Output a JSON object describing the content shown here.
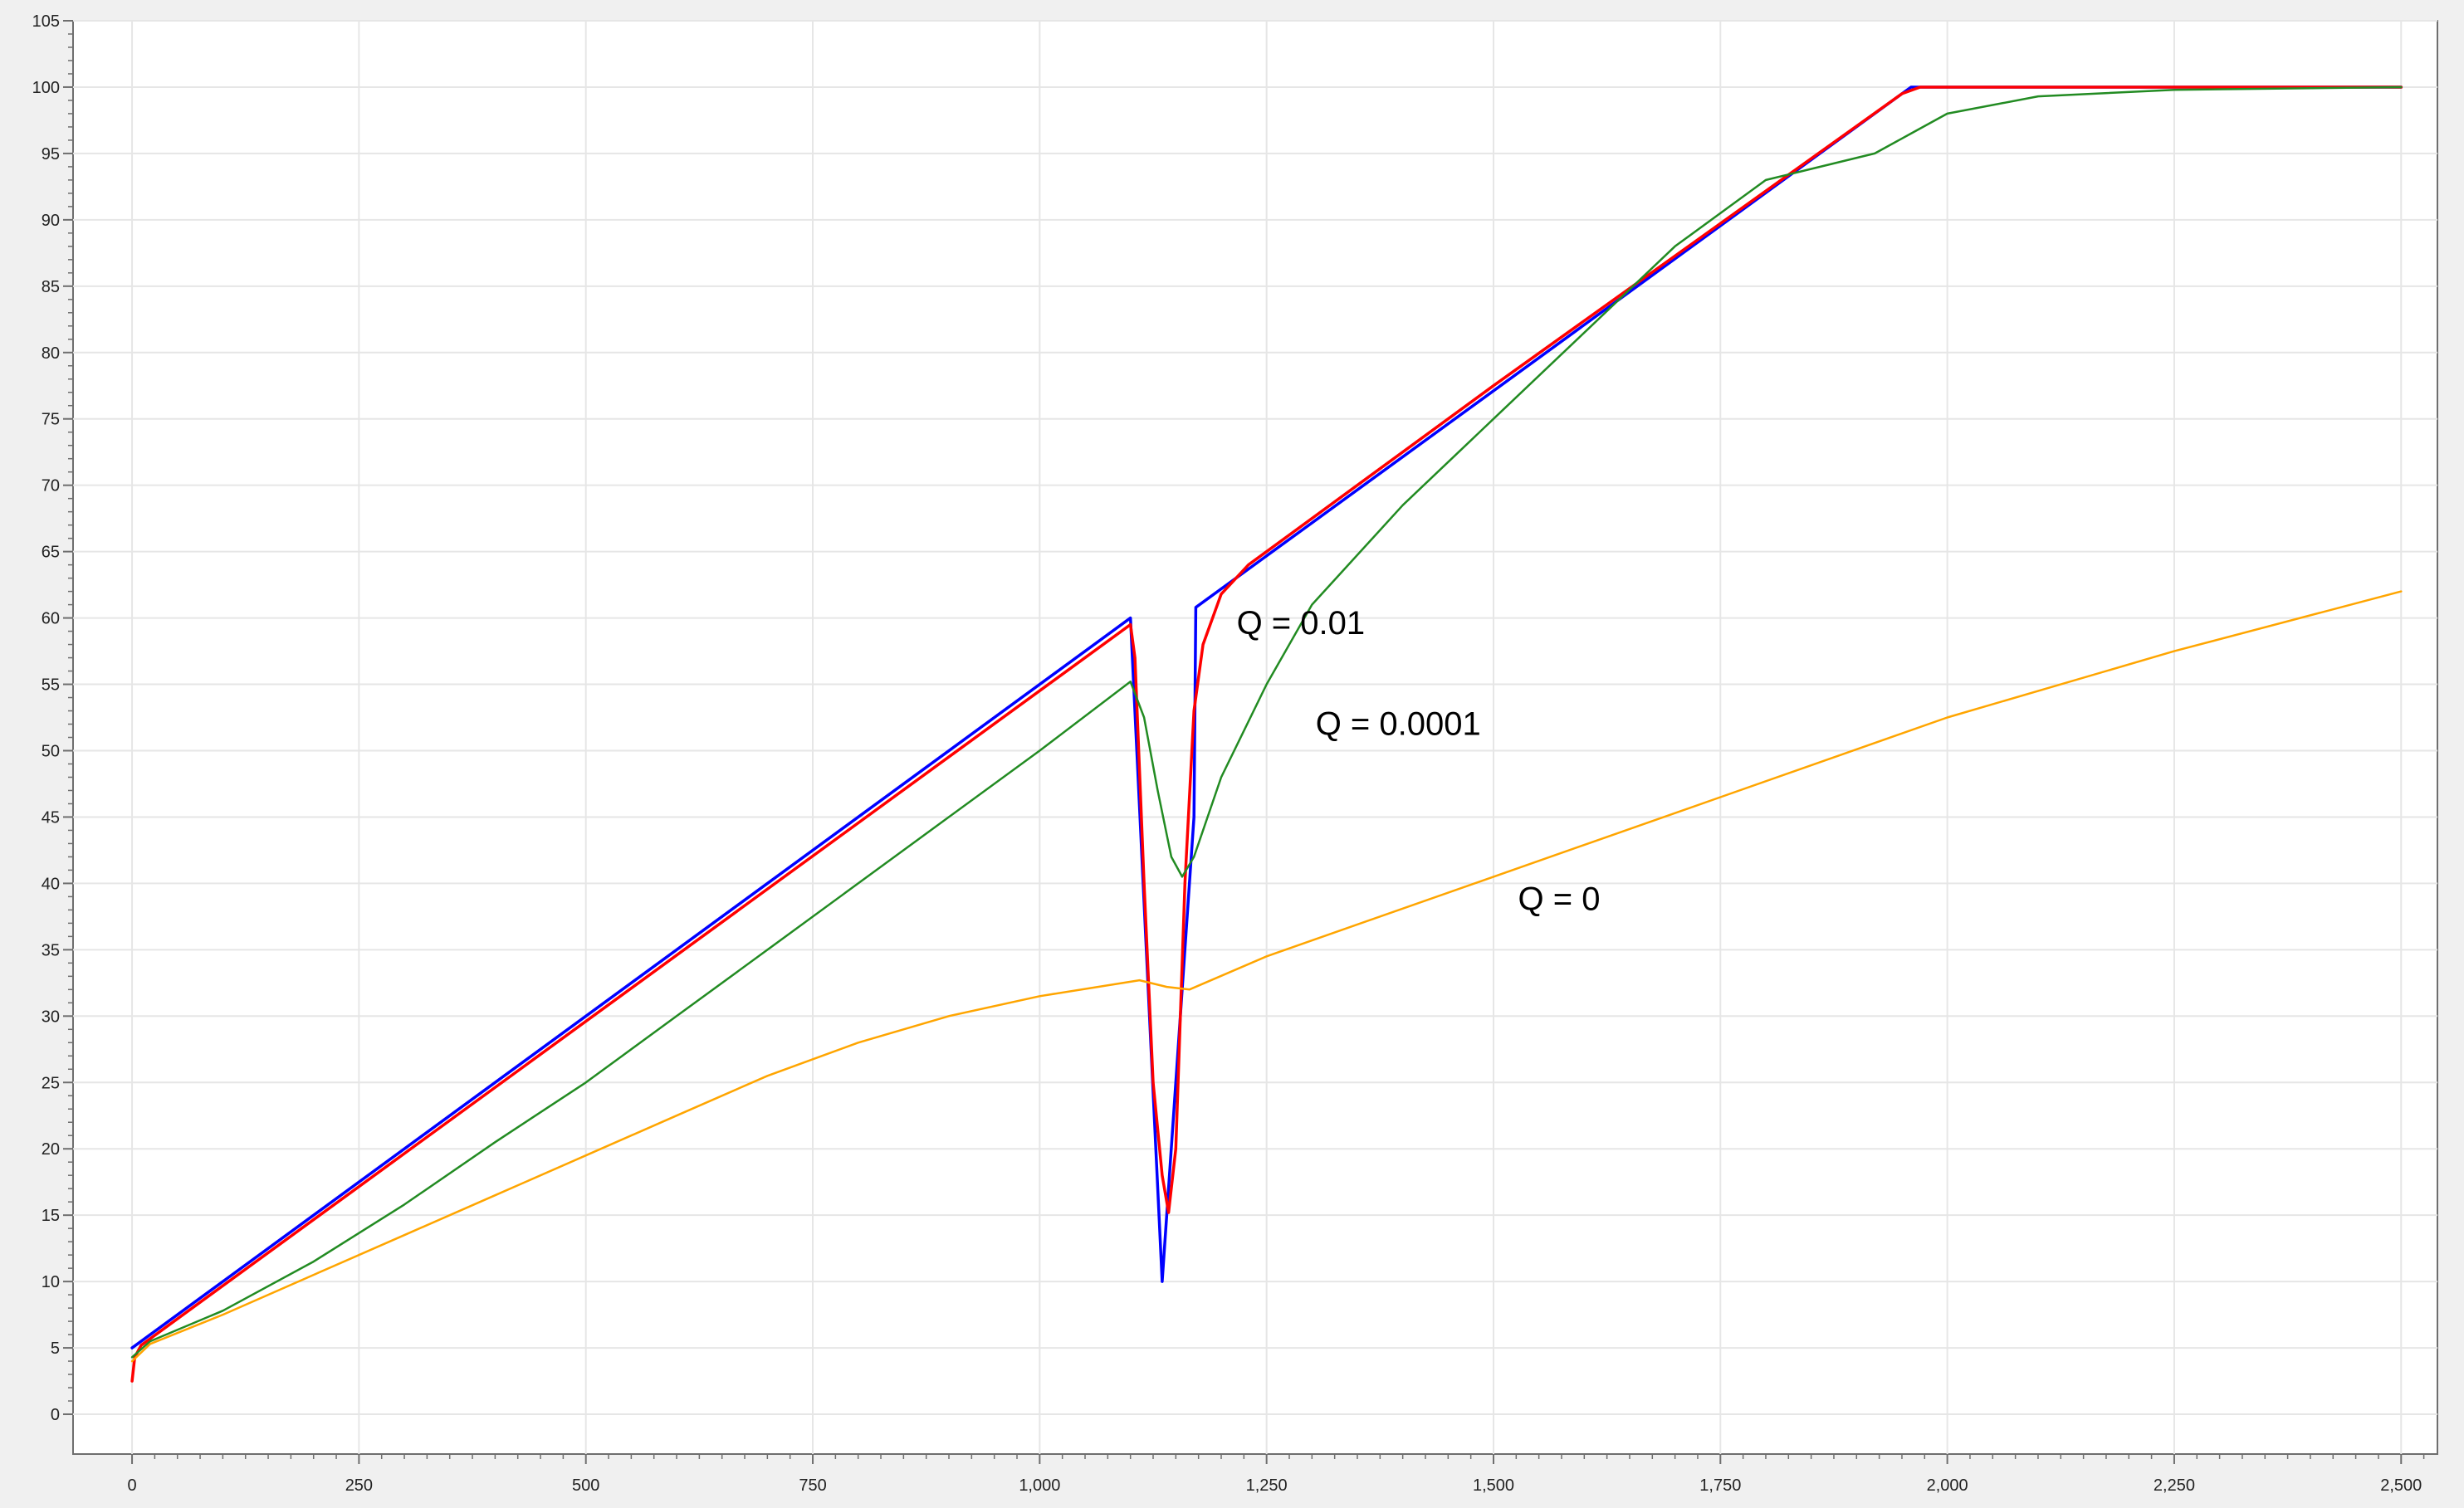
{
  "chart_data": {
    "type": "line",
    "title": "",
    "xlabel": "",
    "ylabel": "",
    "xlim": [
      -65,
      2540
    ],
    "ylim": [
      -3,
      105
    ],
    "x_ticks": [
      {
        "value": 0,
        "label": "0"
      },
      {
        "value": 250,
        "label": "250"
      },
      {
        "value": 500,
        "label": "500"
      },
      {
        "value": 750,
        "label": "750"
      },
      {
        "value": 1000,
        "label": "1,000"
      },
      {
        "value": 1250,
        "label": "1,250"
      },
      {
        "value": 1500,
        "label": "1,500"
      },
      {
        "value": 1750,
        "label": "1,750"
      },
      {
        "value": 2000,
        "label": "2,000"
      },
      {
        "value": 2250,
        "label": "2,250"
      },
      {
        "value": 2500,
        "label": "2,500"
      }
    ],
    "y_ticks": [
      {
        "value": 0,
        "label": "0"
      },
      {
        "value": 5,
        "label": "5"
      },
      {
        "value": 10,
        "label": "10"
      },
      {
        "value": 15,
        "label": "15"
      },
      {
        "value": 20,
        "label": "20"
      },
      {
        "value": 25,
        "label": "25"
      },
      {
        "value": 30,
        "label": "30"
      },
      {
        "value": 35,
        "label": "35"
      },
      {
        "value": 40,
        "label": "40"
      },
      {
        "value": 45,
        "label": "45"
      },
      {
        "value": 50,
        "label": "50"
      },
      {
        "value": 55,
        "label": "55"
      },
      {
        "value": 60,
        "label": "60"
      },
      {
        "value": 65,
        "label": "65"
      },
      {
        "value": 70,
        "label": "70"
      },
      {
        "value": 75,
        "label": "75"
      },
      {
        "value": 80,
        "label": "80"
      },
      {
        "value": 85,
        "label": "85"
      },
      {
        "value": 90,
        "label": "90"
      },
      {
        "value": 95,
        "label": "95"
      },
      {
        "value": 100,
        "label": "100"
      },
      {
        "value": 105,
        "label": "105"
      }
    ],
    "grid": true,
    "legend": "none",
    "series": [
      {
        "color": "#0000ff",
        "points": [
          [
            0,
            5
          ],
          [
            1100,
            60
          ],
          [
            1135,
            10
          ],
          [
            1170,
            45
          ],
          [
            1172,
            60.8
          ],
          [
            1960,
            100
          ],
          [
            2500,
            100
          ]
        ]
      },
      {
        "color": "#ff0000",
        "points": [
          [
            0,
            2.5
          ],
          [
            3,
            4.3
          ],
          [
            10,
            5.2
          ],
          [
            1100,
            59.5
          ],
          [
            1105,
            57
          ],
          [
            1115,
            40
          ],
          [
            1125,
            25
          ],
          [
            1135,
            18
          ],
          [
            1142,
            15.2
          ],
          [
            1150,
            20
          ],
          [
            1160,
            40
          ],
          [
            1170,
            53
          ],
          [
            1180,
            58
          ],
          [
            1200,
            61.8
          ],
          [
            1230,
            64
          ],
          [
            1500,
            77.5
          ],
          [
            1950,
            99.5
          ],
          [
            1970,
            100
          ],
          [
            2500,
            100
          ]
        ]
      },
      {
        "color": "#228b22",
        "points": [
          [
            0,
            4.3
          ],
          [
            20,
            5.5
          ],
          [
            100,
            7.8
          ],
          [
            200,
            11.5
          ],
          [
            300,
            15.8
          ],
          [
            400,
            20.5
          ],
          [
            500,
            25
          ],
          [
            600,
            30
          ],
          [
            700,
            35
          ],
          [
            800,
            40
          ],
          [
            900,
            45
          ],
          [
            1000,
            50
          ],
          [
            1100,
            55.2
          ],
          [
            1115,
            52.5
          ],
          [
            1130,
            47
          ],
          [
            1145,
            42
          ],
          [
            1157,
            40.5
          ],
          [
            1170,
            42
          ],
          [
            1200,
            48
          ],
          [
            1250,
            55
          ],
          [
            1300,
            61
          ],
          [
            1400,
            68.5
          ],
          [
            1500,
            75
          ],
          [
            1600,
            81.5
          ],
          [
            1700,
            88
          ],
          [
            1800,
            93
          ],
          [
            1920,
            95
          ],
          [
            1960,
            96.5
          ],
          [
            2000,
            98
          ],
          [
            2100,
            99.3
          ],
          [
            2250,
            99.8
          ],
          [
            2500,
            100
          ]
        ]
      },
      {
        "color": "#ffa500",
        "points": [
          [
            0,
            4
          ],
          [
            20,
            5.3
          ],
          [
            100,
            7.5
          ],
          [
            200,
            10.5
          ],
          [
            300,
            13.5
          ],
          [
            400,
            16.5
          ],
          [
            500,
            19.5
          ],
          [
            600,
            22.5
          ],
          [
            700,
            25.5
          ],
          [
            800,
            28
          ],
          [
            900,
            30
          ],
          [
            1000,
            31.5
          ],
          [
            1110,
            32.7
          ],
          [
            1140,
            32.2
          ],
          [
            1165,
            32
          ],
          [
            1250,
            34.5
          ],
          [
            1500,
            40.5
          ],
          [
            1750,
            46.5
          ],
          [
            2000,
            52.5
          ],
          [
            2250,
            57.5
          ],
          [
            2500,
            62
          ]
        ]
      }
    ],
    "annotations": [
      {
        "text": "Q = 0.01",
        "x": 1217,
        "y": 58.8
      },
      {
        "text": "Q = 0.0001",
        "x": 1304,
        "y": 51.2
      },
      {
        "text": "Q = 0",
        "x": 1527,
        "y": 38
      }
    ]
  }
}
